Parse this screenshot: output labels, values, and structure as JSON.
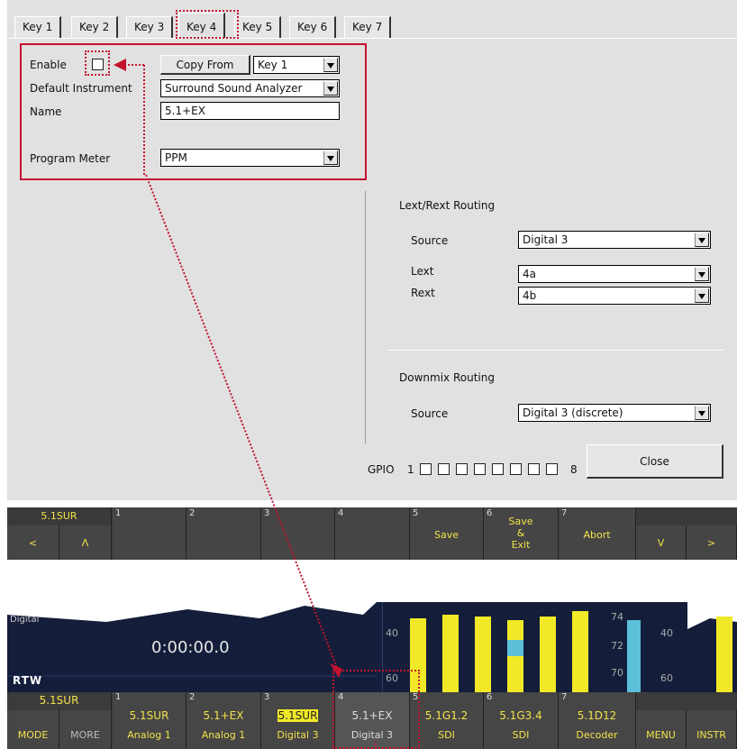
{
  "tabs": [
    "Key 1",
    "Key 2",
    "Key 3",
    "Key 4",
    "Key 5",
    "Key 6",
    "Key 7"
  ],
  "form": {
    "enable_label": "Enable",
    "copy_from_label": "Copy From",
    "copy_from_value": "Key 1",
    "default_instrument_label": "Default Instrument",
    "default_instrument_value": "Surround Sound Analyzer",
    "name_label": "Name",
    "name_value": "5.1+EX",
    "program_meter_label": "Program Meter",
    "program_meter_value": "PPM"
  },
  "lext_rext": {
    "title": "Lext/Rext Routing",
    "source_label": "Source",
    "source_value": "Digital 3",
    "lext_label": "Lext",
    "lext_value": "4a",
    "rext_label": "Rext",
    "rext_value": "4b"
  },
  "downmix": {
    "title": "Downmix Routing",
    "source_label": "Source",
    "source_value": "Digital 3 (discrete)"
  },
  "gpio": {
    "label": "GPIO",
    "start": "1",
    "end": "8",
    "count": 8
  },
  "close_label": "Close",
  "softkeys": {
    "header_label": "5.1SUR",
    "left": "<",
    "up": "Λ",
    "slots": [
      "1",
      "2",
      "3",
      "4",
      "5",
      "6",
      "7"
    ],
    "save": "Save",
    "save_exit_1": "Save",
    "save_exit_2": "&",
    "save_exit_3": "Exit",
    "abort": "Abort",
    "down": "V",
    "right": ">"
  },
  "display": {
    "channel": "Digital",
    "time": "0:00:00.0",
    "logo": "RTW",
    "scale_left": [
      "40",
      "60"
    ],
    "scale_mid": [
      "74",
      "72",
      "70"
    ],
    "scale_right": [
      "40",
      "60"
    ]
  },
  "bottom": {
    "mode_top": "5.1SUR",
    "mode": "MODE",
    "more": "MORE",
    "keys": [
      {
        "n": "1",
        "a": "5.1SUR",
        "b": "Analog 1"
      },
      {
        "n": "2",
        "a": "5.1+EX",
        "b": "Analog 1"
      },
      {
        "n": "3",
        "a": "5.1SUR",
        "b": "Digital 3"
      },
      {
        "n": "4",
        "a": "5.1+EX",
        "b": "Digital 3"
      },
      {
        "n": "5",
        "a": "5.1G1.2",
        "b": "SDI"
      },
      {
        "n": "6",
        "a": "5.1G3.4",
        "b": "SDI"
      },
      {
        "n": "7",
        "a": "5.1D12",
        "b": "Decoder"
      }
    ],
    "menu": "MENU",
    "instr": "INSTR"
  },
  "colors": {
    "accent": "#c4122f",
    "key_text": "#f2e24b",
    "meter": "#f1e928",
    "meter_blue": "#5bc0d8"
  }
}
